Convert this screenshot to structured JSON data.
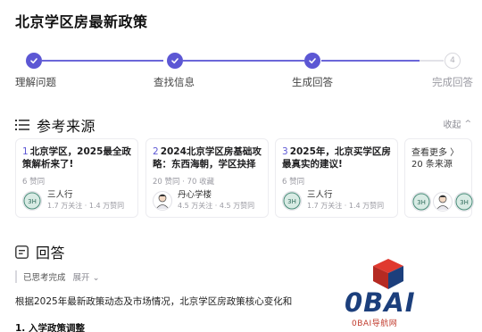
{
  "page_title": "北京学区房最新政策",
  "steps": [
    {
      "label": "理解问题",
      "state": "done"
    },
    {
      "label": "查找信息",
      "state": "done"
    },
    {
      "label": "生成回答",
      "state": "done"
    },
    {
      "label": "完成回答",
      "state": "pending",
      "number": "4"
    }
  ],
  "sources": {
    "heading": "参考来源",
    "collapse_label": "收起",
    "cards": [
      {
        "num": "1",
        "title": "北京学区，2025最全政策解析来了!",
        "meta": "6 赞同",
        "author": "三人行",
        "stats": "1.7 万关注 · 1.4 万赞同",
        "avatar_icon": "badge-avatar-icon"
      },
      {
        "num": "2",
        "title": "2024北京学区房基础攻略：东西海朝，学区抉择",
        "meta": "20 赞同 · 70 收藏",
        "author": "丹心学楼",
        "stats": "4.5 万关注 · 4.5 万赞同",
        "avatar_icon": "person-avatar-icon"
      },
      {
        "num": "3",
        "title": "2025年，北京买学区房最真实的建议!",
        "meta": "6 赞同",
        "author": "三人行",
        "stats": "1.7 万关注 · 1.4 万赞同",
        "avatar_icon": "badge-avatar-icon"
      }
    ],
    "more": {
      "line1": "查看更多 〉",
      "line2": "20 条来源"
    }
  },
  "answer": {
    "heading": "回答",
    "thought_status": "已思考完成",
    "expand_label": "展开",
    "paragraph": "根据2025年最新政策动态及市场情况，北京学区房政策核心变化和",
    "subheading": "1. 入学政策调整"
  },
  "watermark": {
    "brand": "0BAI",
    "sub": "0BAI导航网"
  },
  "colors": {
    "accent": "#5c57d4",
    "brand_blue": "#1c3f7c",
    "brand_red": "#c0392b"
  }
}
